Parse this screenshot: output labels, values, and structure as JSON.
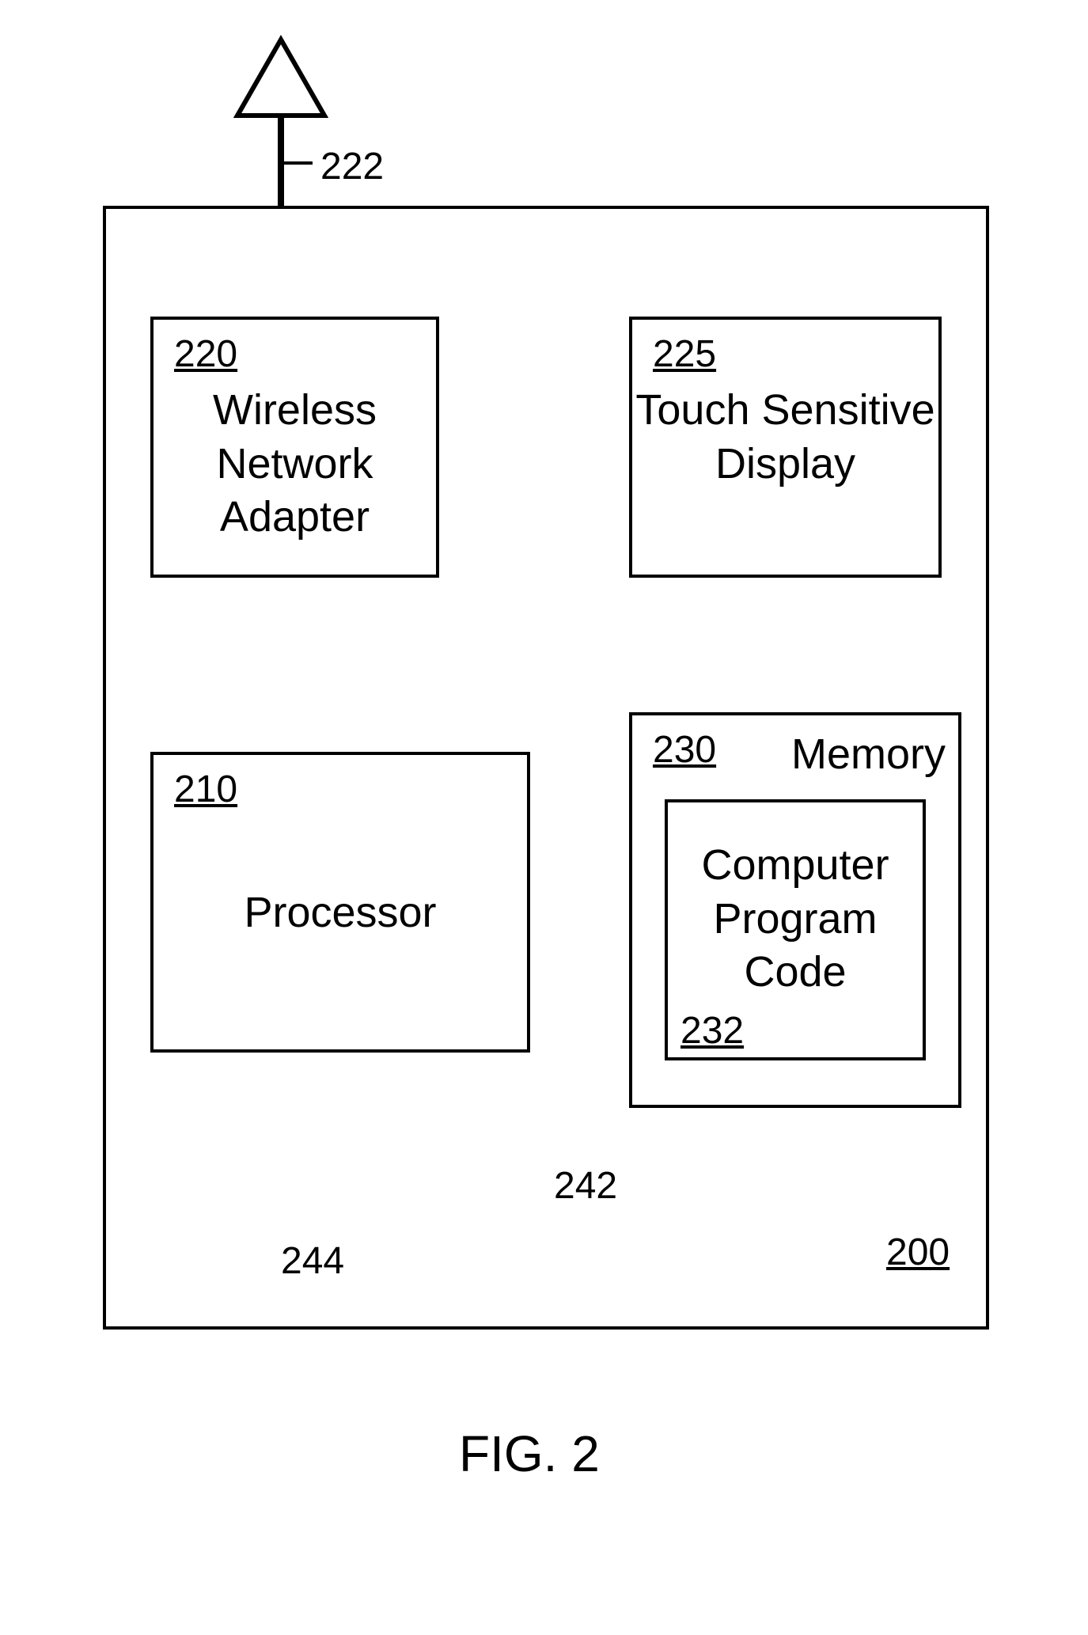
{
  "device": {
    "ref": "200"
  },
  "antenna": {
    "ref": "222"
  },
  "adapter": {
    "ref": "220",
    "label": "Wireless\nNetwork\nAdapter"
  },
  "display": {
    "ref": "225",
    "label": "Touch\nSensitive\nDisplay"
  },
  "processor": {
    "ref": "210",
    "label": "Processor"
  },
  "memory": {
    "ref": "230",
    "label": "Memory"
  },
  "code": {
    "ref": "232",
    "label": "Computer\nProgram\nCode"
  },
  "speaker": {
    "ref": "242"
  },
  "mic": {
    "ref": "244"
  },
  "figure": {
    "label": "FIG. 2"
  }
}
